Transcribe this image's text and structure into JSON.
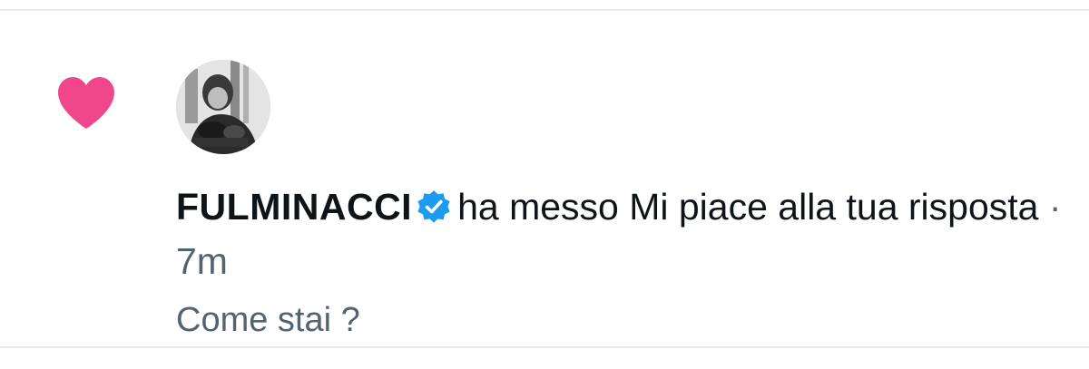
{
  "notification": {
    "type_icon": "heart-icon",
    "avatar_icon": "user-avatar",
    "verified_icon": "verified-badge-icon",
    "username": "FULMINACCI",
    "action_text": "ha messo Mi piace alla tua risposta",
    "separator": "·",
    "timestamp": "7m",
    "reply_text": "Come stai ?"
  },
  "colors": {
    "like": "#F0478C",
    "verified": "#1D9BF0",
    "text": "#0F1419",
    "secondary": "#536471",
    "divider": "#E8EAED"
  }
}
